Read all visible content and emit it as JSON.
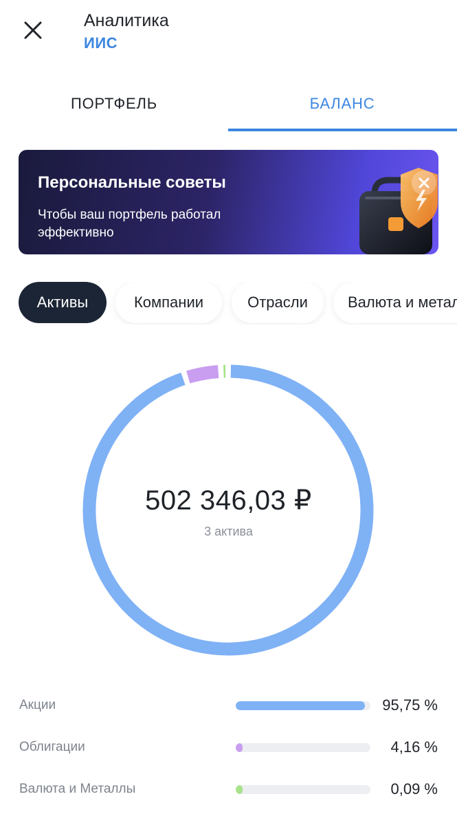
{
  "header": {
    "title": "Аналитика",
    "subtitle": "ИИС"
  },
  "tabs": [
    {
      "label": "ПОРТФЕЛЬ",
      "active": false
    },
    {
      "label": "БАЛАНС",
      "active": true
    }
  ],
  "banner": {
    "title": "Персональные советы",
    "text": "Чтобы ваш портфель работал эффективно"
  },
  "filters": [
    "Активы",
    "Компании",
    "Отрасли",
    "Валюта и металлы"
  ],
  "summary": {
    "total": "502 346,03 ₽",
    "count": "3 актива"
  },
  "allocation": [
    {
      "label": "Акции",
      "percent_label": "95,75 %",
      "value": 95.75,
      "color": "#7fb1f5"
    },
    {
      "label": "Облигации",
      "percent_label": "4,16 %",
      "value": 4.16,
      "color": "#c99df0"
    },
    {
      "label": "Валюта и Металлы",
      "percent_label": "0,09 %",
      "value": 0.09,
      "color": "#a8e38a"
    }
  ],
  "colors": {
    "accent": "#3b86e0",
    "chip_active": "#1c2535",
    "track": "#eceef1"
  },
  "icons": {
    "close": "close-icon",
    "banner": "briefcase-shield-illustration"
  }
}
